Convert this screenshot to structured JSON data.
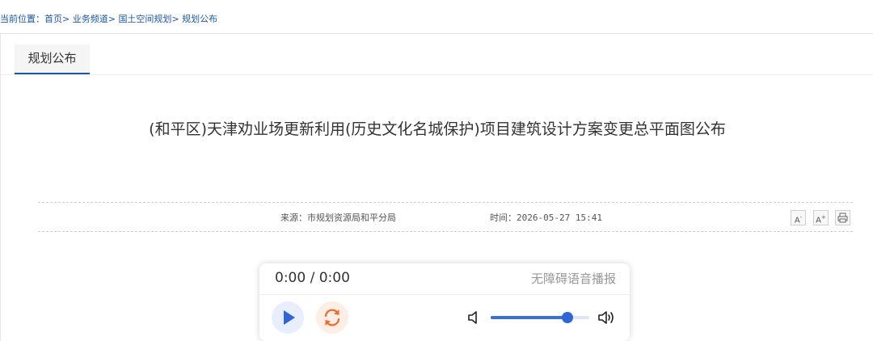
{
  "breadcrumb": {
    "prefix": "当前位置：",
    "items": [
      {
        "label": "首页"
      },
      {
        "label": "业务频道"
      },
      {
        "label": "国土空间规划"
      },
      {
        "label": "规划公布"
      }
    ],
    "separator": ">"
  },
  "tab": {
    "label": "规划公布"
  },
  "article": {
    "title": "(和平区)天津劝业场更新利用(历史文化名城保护)项目建筑设计方案变更总平面图公布",
    "source": "来源：市规划资源局和平分局",
    "time": "时间：2026-05-27 15:41"
  },
  "tools": {
    "font_smaller": "A",
    "font_larger": "A",
    "print_icon": "print-icon"
  },
  "player": {
    "time": "0:00 / 0:00",
    "label": "无障碍语音播报",
    "volume": 0.78,
    "icons": [
      "play-icon",
      "loop-icon",
      "volume-mute-icon",
      "volume-max-icon"
    ]
  },
  "colors": {
    "link": "#1b57a8",
    "accent": "#2f66d6",
    "loop": "#f06a2b"
  }
}
